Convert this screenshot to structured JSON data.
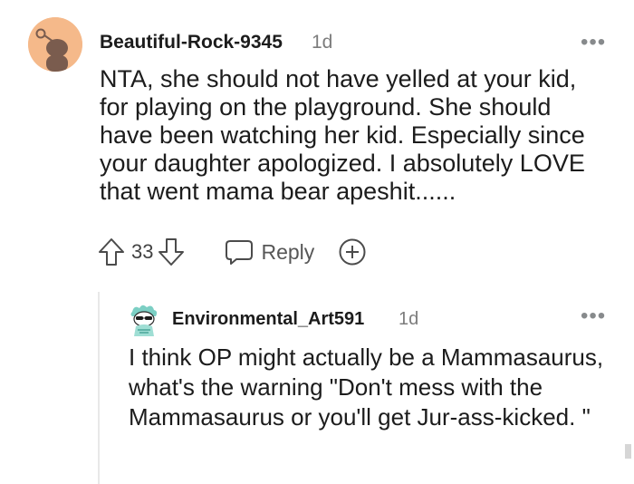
{
  "comment": {
    "username": "Beautiful-Rock-9345",
    "time": "1d",
    "more": "•••",
    "body": "NTA, she should not have yelled at your kid, for playing on the playground. She should have been watching her kid. Especially since your daughter apologized. I absolutely LOVE that went mama bear apeshit......",
    "vote_count": "33",
    "reply_label": "Reply"
  },
  "reply": {
    "username": "Environmental_Art591",
    "time": "1d",
    "more": "•••",
    "body": "I think OP might actually be a Mammasaurus, what's the warning \"Don't mess with the Mammasaurus or you'll get Jur-ass-kicked. \""
  },
  "icons": {
    "avatar_main": "snoo-avatar-icon",
    "avatar_reply": "snoo-avatar-icon",
    "upvote": "upvote-arrow-icon",
    "downvote": "downvote-arrow-icon",
    "reply": "speech-bubble-icon",
    "award": "plus-circle-icon"
  },
  "colors": {
    "avatar_bg": "#f5b98a",
    "text": "#1c1c1c",
    "muted": "#7c7c7c"
  }
}
